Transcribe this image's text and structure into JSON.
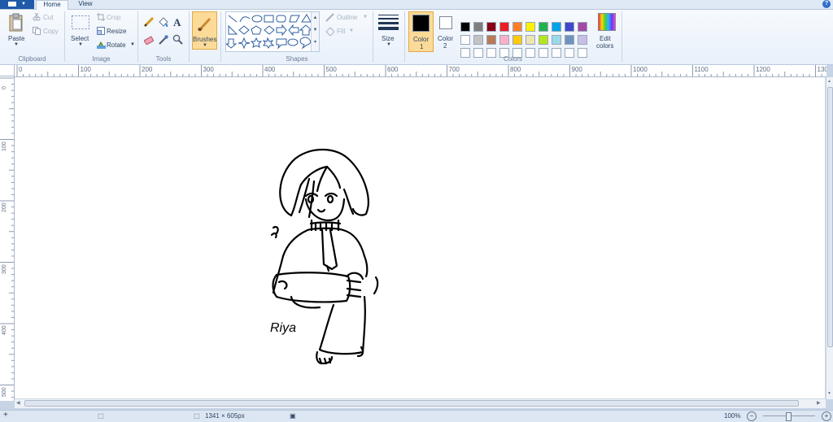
{
  "tabs": {
    "home": "Home",
    "view": "View"
  },
  "help": "?",
  "clipboard": {
    "group": "Clipboard",
    "paste": "Paste",
    "cut": "Cut",
    "copy": "Copy"
  },
  "image": {
    "group": "Image",
    "select": "Select",
    "crop": "Crop",
    "resize": "Resize",
    "rotate": "Rotate"
  },
  "tools": {
    "group": "Tools",
    "text_glyph": "A"
  },
  "brushes": {
    "label": "Brushes"
  },
  "shapes": {
    "group": "Shapes",
    "outline": "Outline",
    "fill": "Fill"
  },
  "size": {
    "label": "Size"
  },
  "colors": {
    "group": "Colors",
    "color1_line1": "Color",
    "color1_line2": "1",
    "color2_line1": "Color",
    "color2_line2": "2",
    "edit_line1": "Edit",
    "edit_line2": "colors",
    "color1": "#000000",
    "color2": "#ffffff",
    "row1": [
      "#000000",
      "#7f7f7f",
      "#880015",
      "#ed1c24",
      "#ff7f27",
      "#fff200",
      "#22b14c",
      "#00a2e8",
      "#3f48cc",
      "#a349a4"
    ],
    "row2": [
      "#ffffff",
      "#c3c3c3",
      "#b97a57",
      "#ffaec9",
      "#ffc90e",
      "#efe4b0",
      "#b5e61d",
      "#99d9ea",
      "#7092be",
      "#c8bfe7"
    ],
    "row3": [
      "#ffffff",
      "#ffffff",
      "#ffffff",
      "#ffffff",
      "#ffffff",
      "#ffffff",
      "#ffffff",
      "#ffffff",
      "#ffffff",
      "#ffffff"
    ]
  },
  "ruler": {
    "h": [
      "0",
      "100",
      "200",
      "300",
      "400",
      "500",
      "600",
      "700",
      "800",
      "900",
      "1000",
      "1100",
      "1200",
      "1300"
    ],
    "v": [
      "0",
      "100",
      "200",
      "300",
      "400",
      "500"
    ]
  },
  "canvas": {
    "signature": "Riya"
  },
  "status": {
    "size": "1341 × 605px",
    "zoom": "100%"
  }
}
